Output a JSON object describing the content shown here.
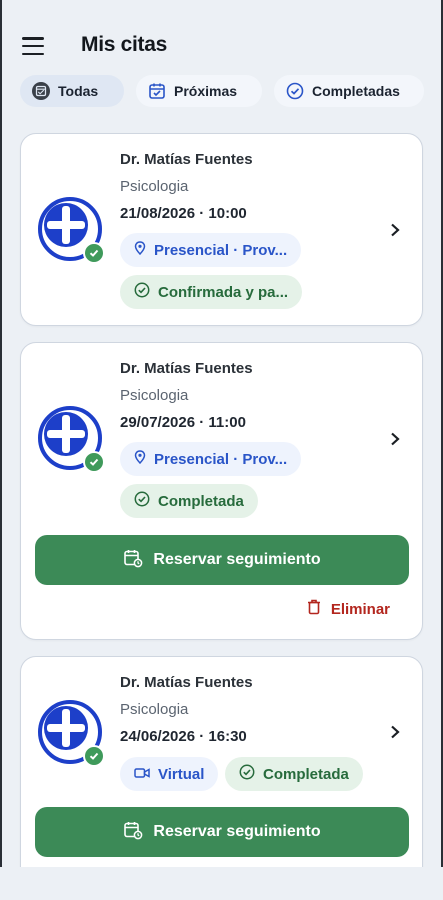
{
  "header": {
    "title": "Mis citas",
    "menu_icon": "hamburger-menu-icon"
  },
  "filters": [
    {
      "label": "Todas",
      "icon": "calendar-all-icon",
      "active": true
    },
    {
      "label": "Próximas",
      "icon": "calendar-icon",
      "active": false
    },
    {
      "label": "Completadas",
      "icon": "check-circle-icon",
      "active": false
    }
  ],
  "appointments": [
    {
      "doctor": "Dr. Matías Fuentes",
      "specialty": "Psicologia",
      "datetime": "21/08/2026 · 10:00",
      "location": "Presencial · Prov...",
      "status": "Confirmada y pa..."
    },
    {
      "doctor": "Dr. Matías Fuentes",
      "specialty": "Psicologia",
      "datetime": "29/07/2026 · 11:00",
      "location": "Presencial · Prov...",
      "status": "Completada",
      "action": "Reservar seguimiento",
      "delete": "Eliminar"
    },
    {
      "doctor": "Dr. Matías Fuentes",
      "specialty": "Psicologia",
      "datetime": "24/06/2026 · 16:30",
      "location": "Virtual",
      "status": "Completada",
      "action": "Reservar seguimiento"
    }
  ],
  "colors": {
    "background": "#ecf0f5",
    "brand_blue": "#1d3fc9",
    "success_green": "#3c8a57",
    "danger_red": "#b3261e"
  }
}
